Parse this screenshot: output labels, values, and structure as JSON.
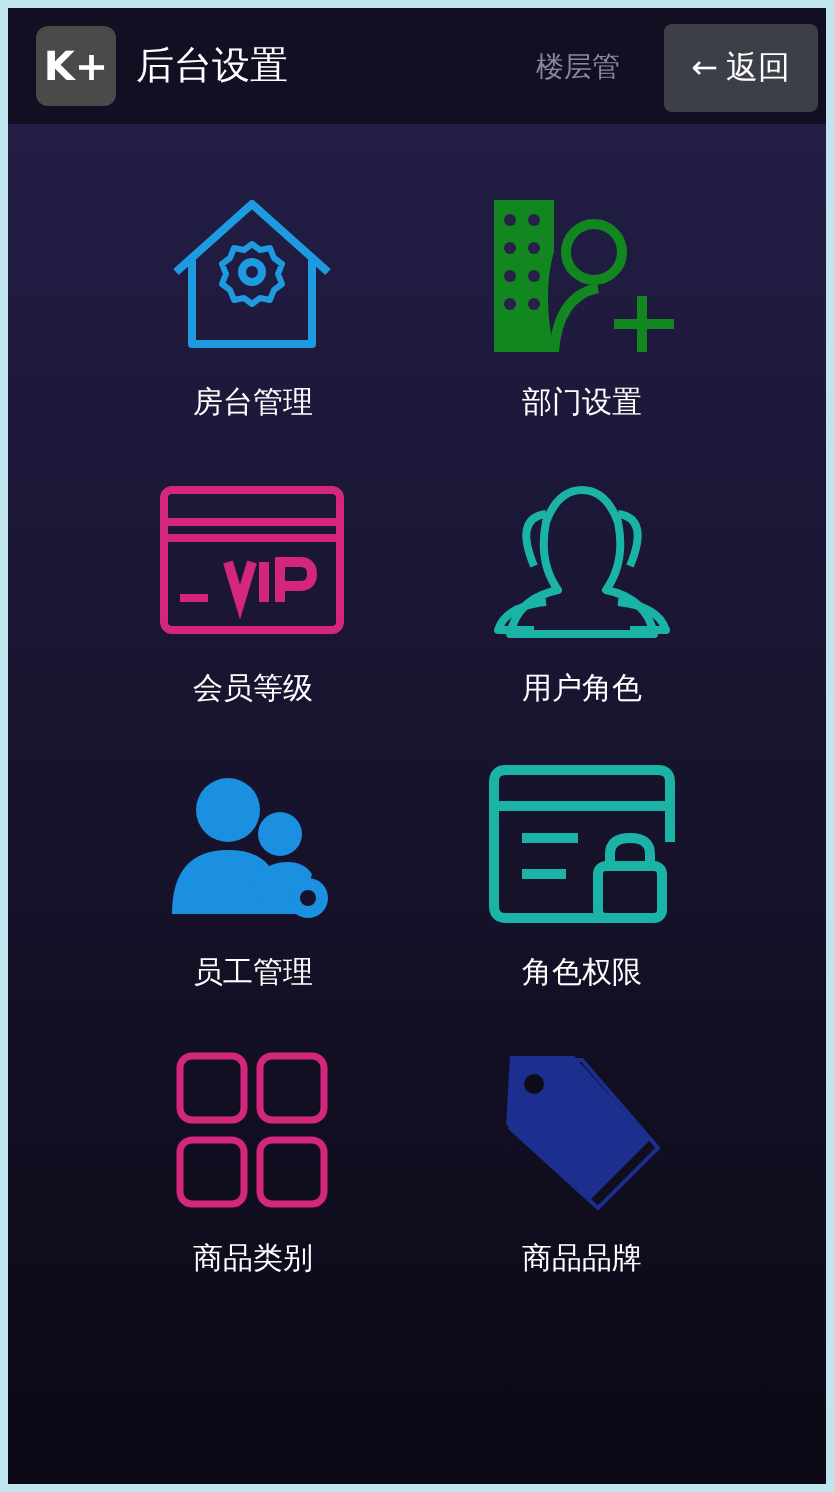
{
  "header": {
    "logo": "K+",
    "title": "后台设置",
    "behind_text": "楼层管",
    "back_button": {
      "arrow": "←",
      "label": "返回"
    }
  },
  "items": [
    {
      "kind": "house",
      "label": "房台管理"
    },
    {
      "kind": "department",
      "label": "部门设置"
    },
    {
      "kind": "vip",
      "label": "会员等级"
    },
    {
      "kind": "users",
      "label": "用户角色"
    },
    {
      "kind": "staff",
      "label": "员工管理"
    },
    {
      "kind": "permission",
      "label": "角色权限"
    },
    {
      "kind": "grid",
      "label": "商品类别"
    },
    {
      "kind": "tag",
      "label": "商品品牌"
    }
  ]
}
